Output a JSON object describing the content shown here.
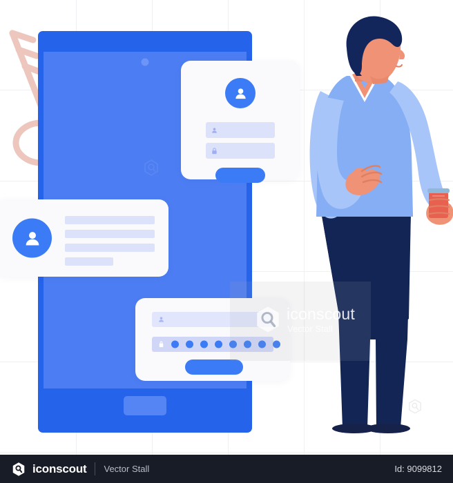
{
  "illustration": {
    "title": "Man standing near mobile login screen",
    "background_color": "#ffffff",
    "grid": {
      "visible": true,
      "color": "#f0f0f2",
      "vertical_x": [
        110,
        220,
        330,
        440,
        550
      ],
      "horizontal_y": [
        130,
        262,
        393,
        524,
        655
      ]
    }
  },
  "key": {
    "name": "key-icon",
    "color": "#EDC6BE",
    "stroke_width": 9,
    "teeth": 3
  },
  "phone": {
    "name": "mobile-phone",
    "frame_color": "#2563EB",
    "screen_color": "#4C7DF2",
    "camera_color": "#6C95F7",
    "home_button_color": "#5585F4",
    "watermark_icon": "iconscout-hexagon-icon"
  },
  "card_top": {
    "name": "login-card",
    "background": "#FAFAFC",
    "avatar_icon": "user-avatar-icon",
    "avatar_color": "#3B7BF5",
    "fields": [
      {
        "icon": "user-icon",
        "label": "username-field",
        "value": ""
      },
      {
        "icon": "lock-icon",
        "label": "password-field",
        "value": ""
      }
    ],
    "button": {
      "label": "",
      "color": "#3B7BF5"
    }
  },
  "card_left": {
    "name": "profile-card",
    "background": "#FAFAFC",
    "avatar_icon": "user-avatar-icon",
    "avatar_color": "#3B7BF5",
    "line_color": "#DDE2FB",
    "lines": [
      130,
      130,
      130,
      70
    ]
  },
  "card_bottom": {
    "name": "password-entry-card",
    "background": "#FAFAFC",
    "fields": [
      {
        "icon": "user-icon",
        "label": "username-field",
        "value": ""
      },
      {
        "icon": "lock-icon",
        "label": "password-field",
        "value": "••••••••"
      }
    ],
    "password_dot_count": 8,
    "dot_color": "#3B7BF5",
    "button": {
      "label": "",
      "color": "#3B7BF5"
    }
  },
  "person": {
    "name": "standing-man",
    "hair_color": "#13265C",
    "skin_color": "#F09275",
    "sweater_color": "#85AEF5",
    "shirt_color": "#A7C5F8",
    "collar_color": "#FFFFFF",
    "trousers_color": "#122554",
    "shoes_color": "#16224A",
    "cup_color": "#E8604F",
    "cup_lid_color": "#8FB8D8"
  },
  "watermark": {
    "title": "iconscout",
    "subtitle": "Vector Stall",
    "logo_icon": "iconscout-hexagon-icon"
  },
  "footer": {
    "brand": "iconscout",
    "separator": "|",
    "subtitle": "Vector Stall",
    "id_label": "Id: 9099812",
    "background": "#181C27",
    "logo_icon": "iconscout-hexagon-icon"
  }
}
